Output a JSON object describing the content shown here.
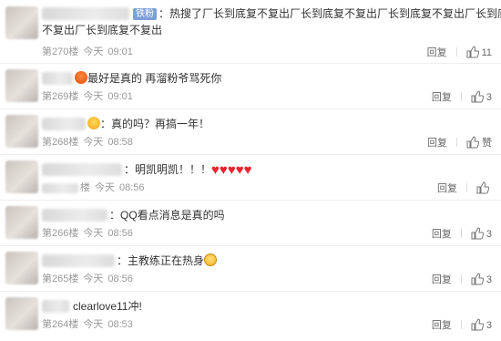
{
  "labels": {
    "reply": "回复"
  },
  "comments": [
    {
      "badge": "铁粉",
      "text_line1": "：热搜了厂长到底复不复出厂长到底复不复出厂长到底复不复出厂长到底复",
      "text_line2": "不复出厂长到底复不复出",
      "floor": "第270楼",
      "day": "今天",
      "time": "09:01",
      "likes": "11"
    },
    {
      "emoji": "angry-face",
      "text": "最好是真的 再溜粉爷骂死你",
      "floor": "第269楼",
      "day": "今天",
      "time": "09:01",
      "likes": "3"
    },
    {
      "emoji": "grin-face",
      "text": "：真的吗？再搞一年！",
      "floor": "第268楼",
      "day": "今天",
      "time": "08:58",
      "likes": "赞"
    },
    {
      "text": "：明凯明凯！！！",
      "hearts": "♥♥♥♥♥",
      "floor": "楼",
      "day": "今天",
      "time": "08:56",
      "likes": ""
    },
    {
      "text": "：QQ看点消息是真的吗",
      "floor": "第266楼",
      "day": "今天",
      "time": "08:56",
      "likes": "3"
    },
    {
      "text": "：主教练正在热身",
      "emoji": "worried-face",
      "floor": "第265楼",
      "day": "今天",
      "time": "08:56",
      "likes": "3"
    },
    {
      "text": "clearlove11冲!",
      "floor": "第264楼",
      "day": "今天",
      "time": "08:53",
      "likes": "3"
    }
  ]
}
